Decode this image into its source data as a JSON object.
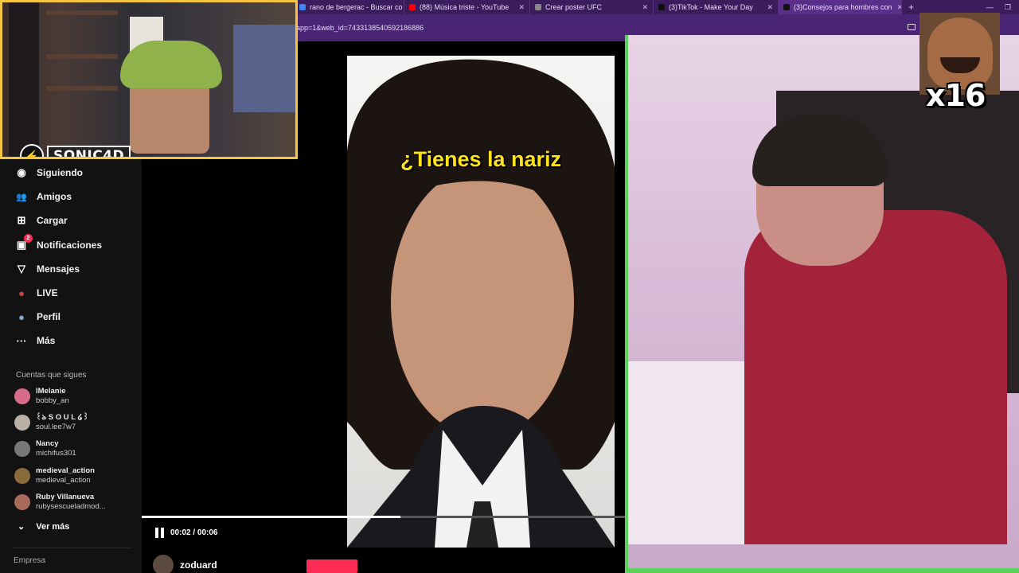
{
  "browser": {
    "tabs": [
      {
        "title": "rano de bergerac - Buscar co",
        "color": "#4285f4"
      },
      {
        "title": "(88) Música triste - YouTube",
        "color": "#ff0000"
      },
      {
        "title": "Crear poster UFC",
        "color": "#888888"
      },
      {
        "title": "(3)TikTok - Make Your Day",
        "color": "#111111"
      },
      {
        "title": "(3)Consejos para hombres con",
        "color": "#111111"
      }
    ],
    "url": "app=1&web_id=7433138540592186886",
    "new_tab": "+",
    "close": "✕"
  },
  "webcam": {
    "channel": "SONIC4D"
  },
  "sidebar": {
    "items": [
      {
        "label": "Siguiendo",
        "icon": "following-icon",
        "glyph": "◉"
      },
      {
        "label": "Amigos",
        "icon": "friends-icon",
        "glyph": "👥"
      },
      {
        "label": "Cargar",
        "icon": "upload-icon",
        "glyph": "⊞"
      },
      {
        "label": "Notificaciones",
        "icon": "notifications-icon",
        "glyph": "▣",
        "badge": "2"
      },
      {
        "label": "Mensajes",
        "icon": "messages-icon",
        "glyph": "▽"
      },
      {
        "label": "LIVE",
        "icon": "live-icon",
        "glyph": "●"
      },
      {
        "label": "Perfil",
        "icon": "profile-icon",
        "glyph": "●"
      },
      {
        "label": "Más",
        "icon": "more-icon",
        "glyph": "···"
      }
    ],
    "following_title": "Cuentas que sigues",
    "accounts": [
      {
        "name": "lMelanie",
        "user": "bobby_an",
        "color": "#d66b8a"
      },
      {
        "name": "꒰ঌ S O U L ໒꒱",
        "user": "soul.lee7w7",
        "color": "#b9b0a8"
      },
      {
        "name": "Nancy",
        "user": "michifus301",
        "color": "#777777"
      },
      {
        "name": "medieval_action",
        "user": "medieval_action",
        "color": "#8a6b3c"
      },
      {
        "name": "Ruby Villanueva",
        "user": "rubysescueladmod...",
        "color": "#a86a5a"
      }
    ],
    "see_more": "Ver más",
    "footer": "Empresa"
  },
  "player": {
    "caption": "¿Tienes la nariz",
    "time": "00:02 / 00:06",
    "progress": 0.535,
    "author": "zoduard"
  },
  "overlay": {
    "multiplier": "x16"
  }
}
